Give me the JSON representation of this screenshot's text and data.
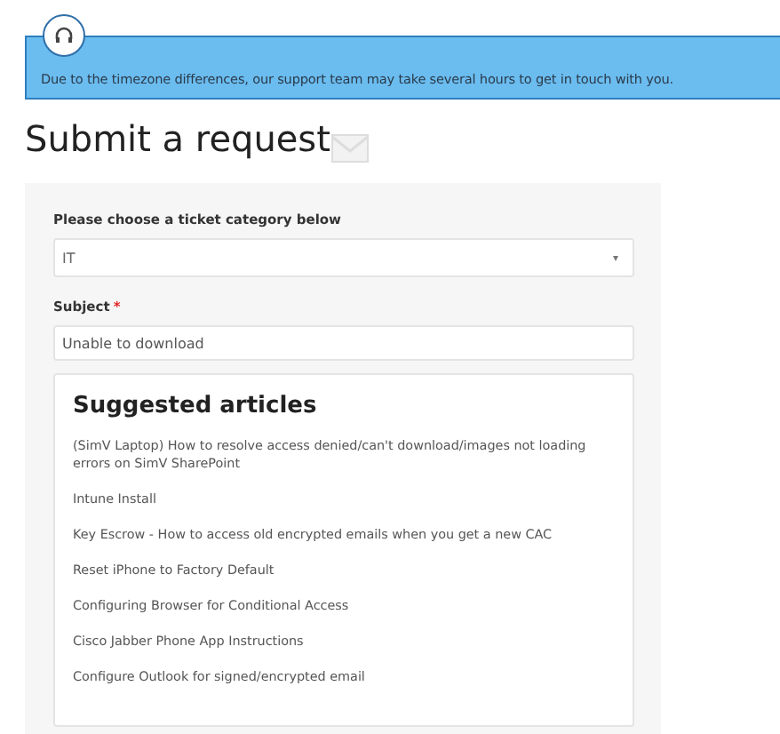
{
  "notice": {
    "text": "Due to the timezone differences, our support team may take several hours to get in touch with you."
  },
  "title": "Submit a request",
  "form": {
    "category": {
      "label": "Please choose a ticket category below",
      "value": "IT",
      "caret": "▾"
    },
    "subject": {
      "label": "Subject",
      "required_mark": "*",
      "value": "Unable to download"
    },
    "suggested": {
      "heading": "Suggested articles",
      "articles": [
        "(SimV Laptop) How to resolve access denied/can't download/images not loading errors on SimV SharePoint",
        "Intune Install",
        "Key Escrow - How to access old encrypted emails when you get a new CAC",
        "Reset iPhone to Factory Default",
        "Configuring Browser for Conditional Access",
        "Cisco Jabber Phone App Instructions",
        "Configure Outlook for signed/encrypted email"
      ]
    }
  }
}
